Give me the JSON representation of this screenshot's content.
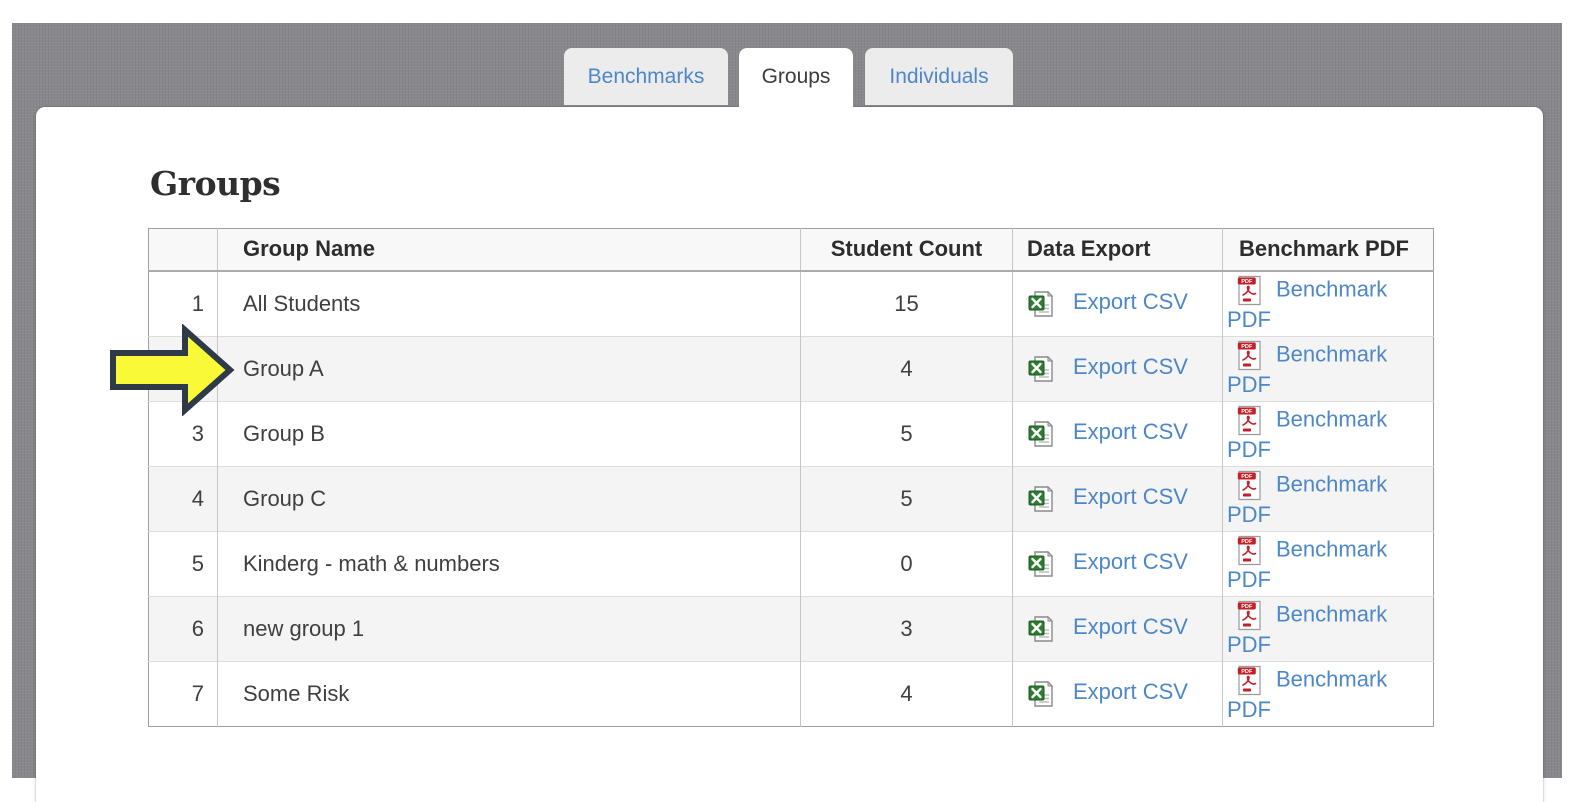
{
  "tabs": [
    {
      "label": "Benchmarks",
      "active": false
    },
    {
      "label": "Groups",
      "active": true
    },
    {
      "label": "Individuals",
      "active": false
    }
  ],
  "page": {
    "heading": "Groups"
  },
  "table": {
    "headers": {
      "row_number": "",
      "group_name": "Group Name",
      "student_count": "Student Count",
      "data_export": "Data Export",
      "benchmark_pdf": "Benchmark PDF"
    },
    "export_csv_label": "Export CSV",
    "benchmark_pdf_label": "Benchmark PDF",
    "rows": [
      {
        "num": "1",
        "name": "All Students",
        "count": "15"
      },
      {
        "num": "",
        "name": "Group A",
        "count": "4"
      },
      {
        "num": "3",
        "name": "Group B",
        "count": "5"
      },
      {
        "num": "4",
        "name": "Group C",
        "count": "5"
      },
      {
        "num": "5",
        "name": "Kinderg - math & numbers",
        "count": "0"
      },
      {
        "num": "6",
        "name": "new group 1",
        "count": "3"
      },
      {
        "num": "7",
        "name": "Some Risk",
        "count": "4"
      }
    ]
  },
  "icons": {
    "excel": "excel-file-icon",
    "pdf": "pdf-file-icon"
  },
  "annotations": {
    "arrow": {
      "shape": "right-pointing-arrow",
      "points_at_row": "Group A"
    }
  },
  "colors": {
    "link_blue": "#4d87c9",
    "backdrop_gray": "#89898d",
    "row_stripe": "#f4f4f4",
    "arrow_fill": "#f9f938",
    "arrow_stroke": "#2e3a47"
  }
}
